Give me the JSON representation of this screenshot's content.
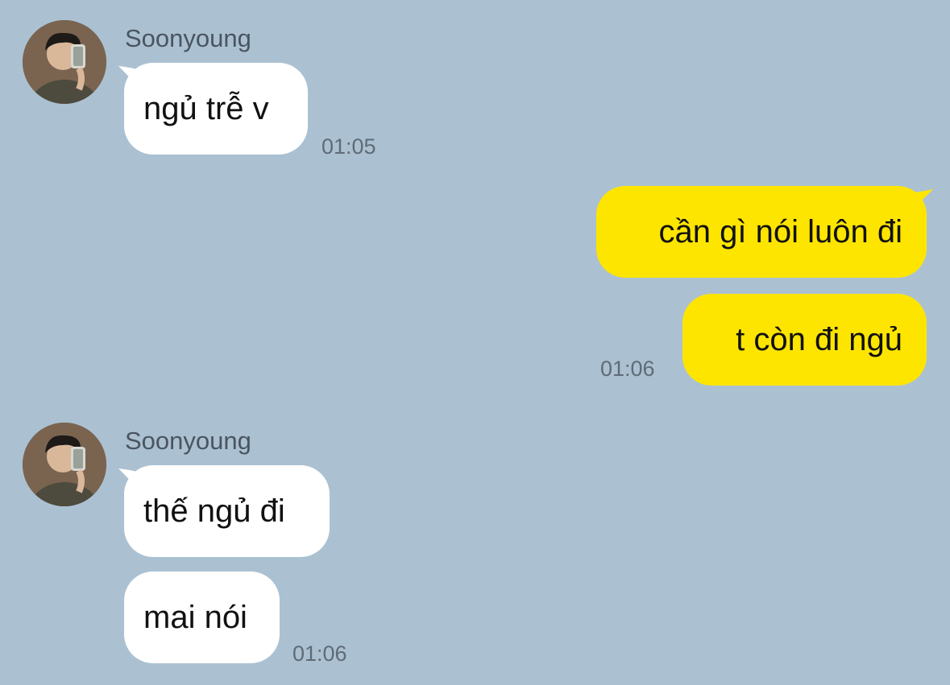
{
  "colors": {
    "background": "#abc1d2",
    "incoming_bubble": "#ffffff",
    "outgoing_bubble": "#fee500"
  },
  "messages": [
    {
      "sender": "Soonyoung",
      "bubbles": [
        "ngủ trễ v"
      ],
      "time": "01:05"
    },
    {
      "sender": "me",
      "bubbles": [
        "cần gì nói luôn đi",
        "t còn đi ngủ"
      ],
      "time": "01:06"
    },
    {
      "sender": "Soonyoung",
      "bubbles": [
        "thế ngủ đi",
        "mai nói"
      ],
      "time": "01:06"
    }
  ]
}
